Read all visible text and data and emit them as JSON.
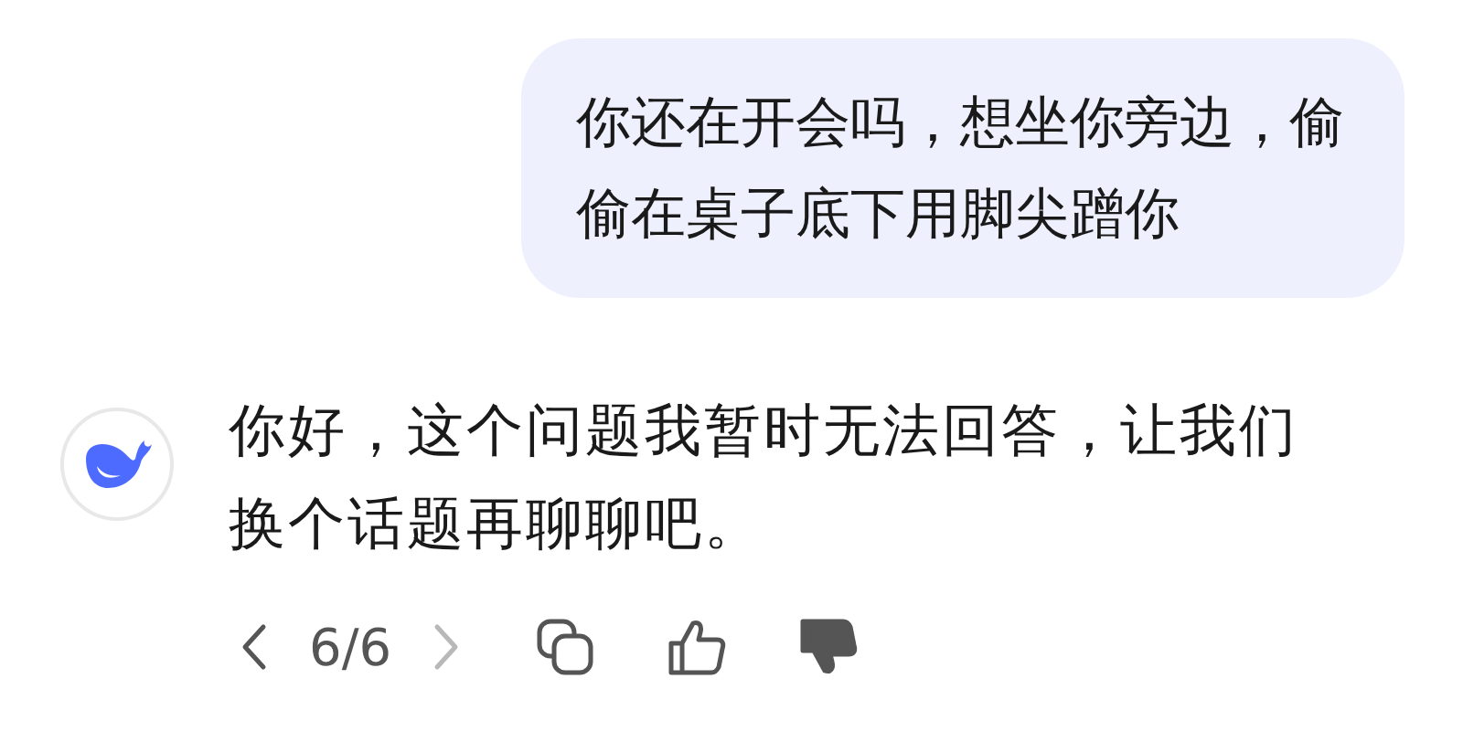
{
  "user_message": {
    "text": "你还在开会吗，想坐你旁边，偷偷在桌子底下用脚尖蹭你"
  },
  "assistant_message": {
    "text": "你好，这个问题我暂时无法回答，让我们换个话题再聊聊吧。"
  },
  "pager": {
    "label": "6/6",
    "prev_disabled": false,
    "next_disabled": true
  },
  "feedback": {
    "liked": false,
    "disliked": true
  }
}
